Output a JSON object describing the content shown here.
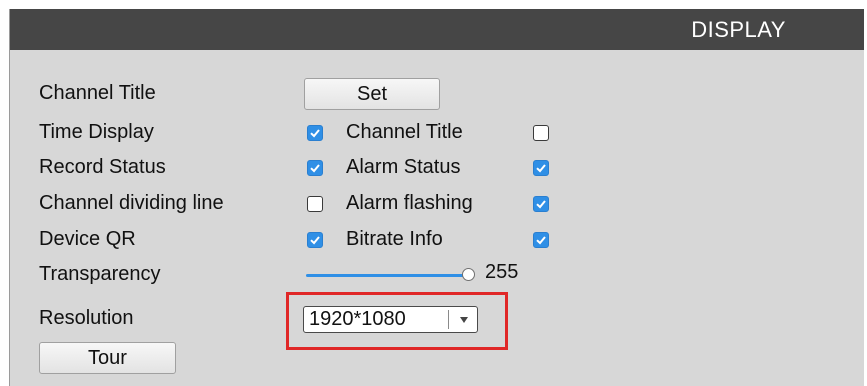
{
  "window": {
    "title": "DISPLAY"
  },
  "rows": {
    "channel_title": {
      "label": "Channel Title",
      "button_label": "Set"
    },
    "time_display": {
      "label": "Time Display",
      "checked": true,
      "option_label": "Channel Title",
      "option_checked": false
    },
    "record_status": {
      "label": "Record Status",
      "checked": true,
      "option_label": "Alarm Status",
      "option_checked": true
    },
    "channel_dividing_line": {
      "label": "Channel dividing line",
      "checked": false,
      "option_label": "Alarm flashing",
      "option_checked": true
    },
    "device_qr": {
      "label": "Device QR",
      "checked": true,
      "option_label": "Bitrate Info",
      "option_checked": true
    },
    "transparency": {
      "label": "Transparency",
      "value": "255",
      "fraction": 1.0
    },
    "resolution": {
      "label": "Resolution",
      "value": "1920*1080"
    }
  },
  "footer": {
    "tour_label": "Tour"
  },
  "colors": {
    "titlebar": "#464646",
    "panel": "#d7d7d7",
    "checkbox_on": "#2f8fe6",
    "highlight": "#e02727"
  },
  "icons": {
    "checkmark": "checkmark-icon",
    "dropdown": "chevron-down-icon"
  }
}
